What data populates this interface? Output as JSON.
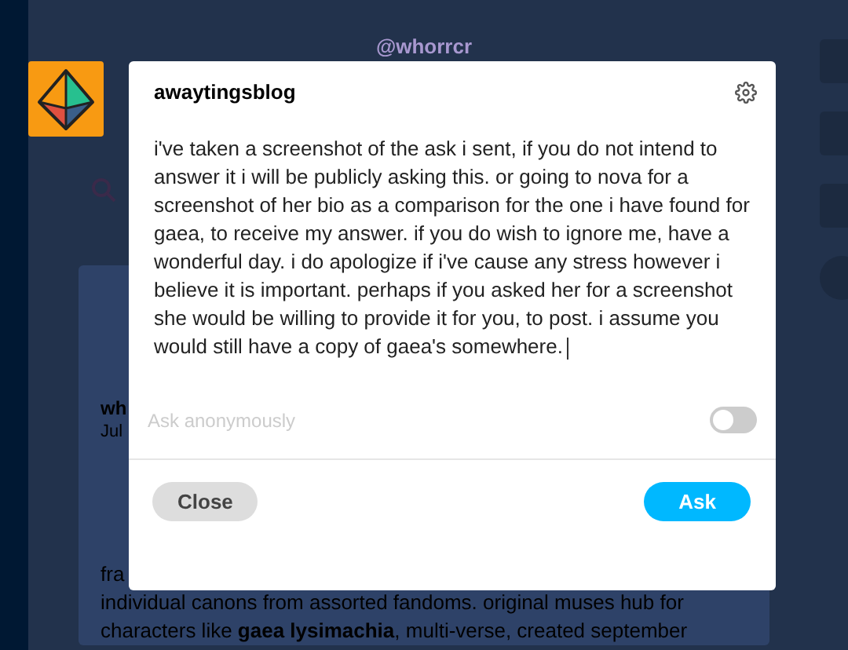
{
  "background": {
    "handle": "@whorrcr",
    "post": {
      "author": "wh",
      "date": "Jul",
      "bio_lines": [
        "fra",
        "individual canons from assorted fandoms.   original muses hub for",
        "characters like **gaea lysimachia**,  multi-verse,  created september"
      ]
    }
  },
  "dialog": {
    "title": "awaytingsblog",
    "message": "i've taken a screenshot of the ask i sent, if you do not intend to answer it i will be publicly asking this. or going to nova for a screenshot of her bio as a comparison for the one i have found for gaea, to receive my answer. if you do wish to ignore me, have a wonderful day. i do apologize if i've cause any stress however i believe it is important. perhaps if you asked her for a screenshot she would be willing to provide it for you, to post. i assume you would still have a copy of gaea's somewhere.",
    "anonymous": {
      "label": "Ask anonymously",
      "on": false
    },
    "buttons": [
      {
        "label": "Close",
        "kind": "secondary"
      },
      {
        "label": "Ask",
        "kind": "primary"
      }
    ]
  }
}
